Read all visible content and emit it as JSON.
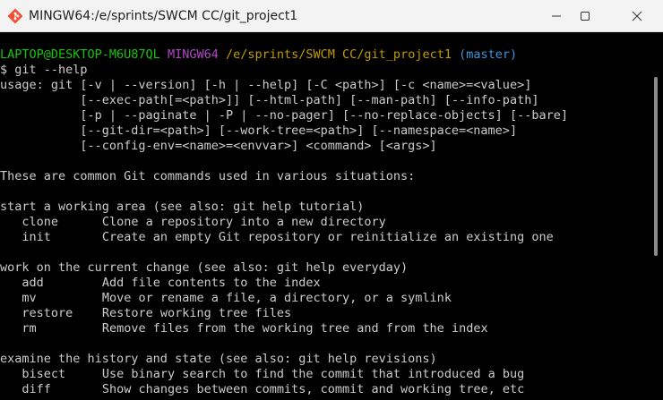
{
  "window": {
    "title": "MINGW64:/e/sprints/SWCM CC/git_project1",
    "icon": "git-bash-icon",
    "controls": {
      "minimize": "minimize-icon",
      "maximize": "maximize-icon",
      "close": "close-icon"
    }
  },
  "prompt": {
    "user_host": "LAPTOP@DESKTOP-M6U87QL",
    "shell": "MINGW64",
    "path": "/e/sprints/SWCM CC/git_project1",
    "branch": "(master)",
    "command": "$ git --help"
  },
  "output": {
    "usage": [
      "usage: git [-v | --version] [-h | --help] [-C <path>] [-c <name>=<value>]",
      "           [--exec-path[=<path>]] [--html-path] [--man-path] [--info-path]",
      "           [-p | --paginate | -P | --no-pager] [--no-replace-objects] [--bare]",
      "           [--git-dir=<path>] [--work-tree=<path>] [--namespace=<name>]",
      "           [--config-env=<name>=<envvar>] <command> [<args>]"
    ],
    "intro": "These are common Git commands used in various situations:",
    "sections": [
      {
        "heading": "start a working area (see also: git help tutorial)",
        "commands": [
          {
            "name": "clone",
            "desc": "Clone a repository into a new directory"
          },
          {
            "name": "init",
            "desc": "Create an empty Git repository or reinitialize an existing one"
          }
        ]
      },
      {
        "heading": "work on the current change (see also: git help everyday)",
        "commands": [
          {
            "name": "add",
            "desc": "Add file contents to the index"
          },
          {
            "name": "mv",
            "desc": "Move or rename a file, a directory, or a symlink"
          },
          {
            "name": "restore",
            "desc": "Restore working tree files"
          },
          {
            "name": "rm",
            "desc": "Remove files from the working tree and from the index"
          }
        ]
      },
      {
        "heading": "examine the history and state (see also: git help revisions)",
        "commands": [
          {
            "name": "bisect",
            "desc": "Use binary search to find the commit that introduced a bug"
          },
          {
            "name": "diff",
            "desc": "Show changes between commits, commit and working tree, etc"
          }
        ]
      }
    ]
  },
  "colors": {
    "user_host": "#16c60c",
    "shell": "#b148c6",
    "path": "#c19c00",
    "branch": "#3a96dd",
    "text": "#cccccc",
    "background": "#000000"
  }
}
